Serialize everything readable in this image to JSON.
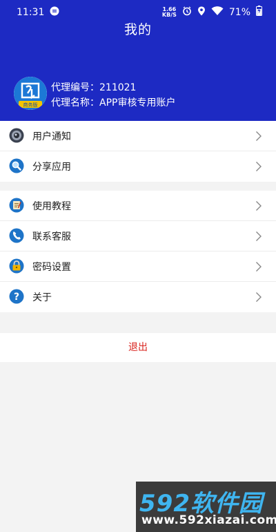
{
  "status_bar": {
    "time": "11:31",
    "net_speed_value": "1.66",
    "net_speed_unit": "KB/S",
    "battery": "71%"
  },
  "header": {
    "title": "我的"
  },
  "agent": {
    "number_line": "代理编号：211021",
    "name_line": "代理名称：APP审核专用账户",
    "avatar_badge": "商务版"
  },
  "menu": {
    "group1": [
      {
        "label": "用户通知",
        "icon": "speaker-icon"
      },
      {
        "label": "分享应用",
        "icon": "magnifier-icon"
      }
    ],
    "group2": [
      {
        "label": "使用教程",
        "icon": "notebook-icon"
      },
      {
        "label": "联系客服",
        "icon": "phone-icon"
      },
      {
        "label": "密码设置",
        "icon": "lock-icon"
      },
      {
        "label": "关于",
        "icon": "help-icon"
      }
    ]
  },
  "logout_label": "退出",
  "watermark": {
    "top": "592软件园",
    "bottom": "www.592xiazai.com"
  },
  "colors": {
    "header_bg": "#1d2ac3",
    "logout_text": "#d9231e",
    "page_bg": "#f3f3f3"
  }
}
